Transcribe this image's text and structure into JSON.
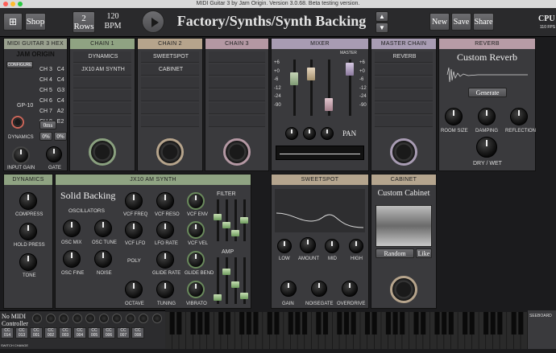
{
  "window": {
    "title": "MIDI Guitar 3  by Jam Origin.  Version 3.0.68.  Beta testing version."
  },
  "toolbar": {
    "shop": "Shop",
    "rows_num": "2",
    "rows_label": "Rows",
    "bpm_num": "120",
    "bpm_label": "BPM",
    "preset": "Factory/Synths/Synth Backing",
    "new": "New",
    "save": "Save",
    "share": "Share",
    "cpu": "CPU",
    "fps": "110 FPS"
  },
  "colors": {
    "chain1": "#8fa382",
    "chain2": "#b6a48c",
    "chain3": "#b498a3",
    "mixer": "#a89cb3",
    "reverb": "#b79ca6",
    "sweetspot": "#b5a58e",
    "dynamics": "#8fa382"
  },
  "midi": {
    "header": "MIDI GUITAR 3 HEX",
    "brand": "JAM ORIGIN",
    "configure": "CONFIGURE",
    "channels": [
      {
        "ch": "CH 3",
        "note": "C4"
      },
      {
        "ch": "CH 4",
        "note": "C4"
      },
      {
        "ch": "CH 5",
        "note": "G3"
      },
      {
        "ch": "CH 6",
        "note": "C4"
      },
      {
        "ch": "CH 7",
        "note": "A2"
      },
      {
        "ch": "CH 8",
        "note": "E2"
      }
    ],
    "model": "GP-10",
    "dynamics": "DYNAMICS",
    "latency": "0ms",
    "pct1": "0%",
    "pct2": "0%",
    "input_gain": "INPUT GAIN",
    "gate": "GATE"
  },
  "chain1": {
    "header": "CHAIN 1",
    "items": [
      "DYNAMICS",
      "JX10 AM SYNTH"
    ]
  },
  "chain2": {
    "header": "CHAIN 2",
    "items": [
      "SWEETSPOT",
      "CABINET"
    ]
  },
  "chain3": {
    "header": "CHAIN 3"
  },
  "mixer": {
    "header": "MIXER",
    "master": "MASTER",
    "scale": [
      "+6",
      "+0",
      "-6",
      "-12",
      "-24",
      "-90"
    ],
    "pan": "PAN"
  },
  "master_chain": {
    "header": "MASTER CHAIN",
    "item": "REVERB"
  },
  "reverb": {
    "header": "REVERB",
    "title": "Custom Reverb",
    "generate": "Generate",
    "room": "ROOM SIZE",
    "damping": "DAMPING",
    "reflection": "REFLECTION",
    "drywet": "DRY / WET"
  },
  "dynamics": {
    "header": "DYNAMICS",
    "compress": "COMPRESS",
    "hold": "HOLD PRESS",
    "tone": "TONE"
  },
  "jx10": {
    "header": "JX10 AM SYNTH",
    "title": "Solid Backing",
    "osc": "OSCILLATORS",
    "osc_mix": "OSC MIX",
    "osc_tune": "OSC TUNE",
    "osc_fine": "OSC FINE",
    "noise": "NOISE",
    "vcf_freq": "VCF FREQ",
    "vcf_reso": "VCF RESO",
    "vcf_env": "VCF ENV",
    "vcf_lfo": "VCF LFO",
    "lfo_rate": "LFO RATE",
    "vcf_vel": "VCF VEL",
    "poly": "POLY",
    "glide_rate": "GLIDE RATE",
    "glide_bend": "GLIDE BEND",
    "octave": "OCTAVE",
    "tuning": "TUNING",
    "vibrato": "VIBRATO",
    "filter": "FILTER",
    "amp": "AMP"
  },
  "sweetspot": {
    "header": "SWEETSPOT",
    "low": "LOW",
    "amount": "AMOUNT",
    "mid": "MID",
    "high": "HIGH",
    "gain": "GAIN",
    "noisegate": "NOISEGATE",
    "overdrive": "OVERDRIVE"
  },
  "cabinet": {
    "header": "CABINET",
    "title": "Custom Cabinet",
    "random": "Random",
    "like": "Like"
  },
  "footer": {
    "no_midi": "No MIDI",
    "controller": "Controller",
    "switch": "SWITCH CHANGE",
    "cc": [
      "CC 014",
      "CC 013",
      "CC 001",
      "CC 002",
      "CC 003",
      "CC 004",
      "CC 005",
      "CC 006",
      "CC 007",
      "CC 008"
    ],
    "keyboard": "SEEBOARD"
  }
}
